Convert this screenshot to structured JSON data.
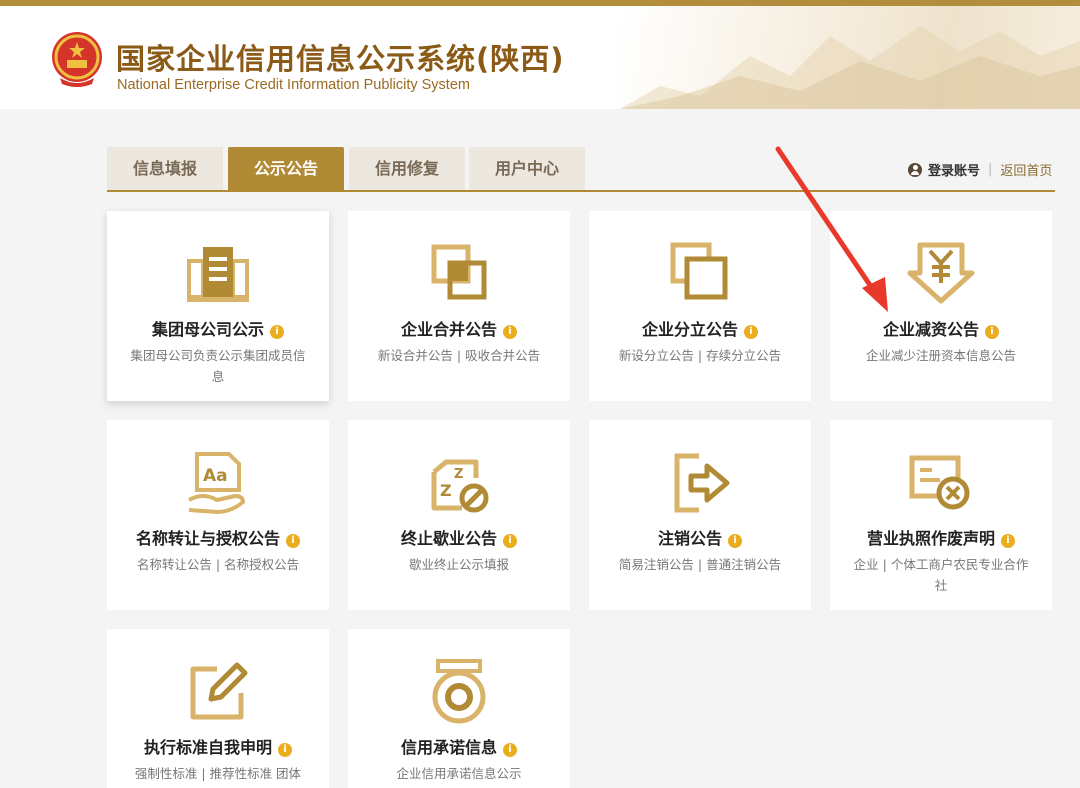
{
  "header": {
    "title": "国家企业信用信息公示系统(陕西)",
    "subtitle": "National Enterprise Credit Information Publicity System"
  },
  "nav": {
    "tabs": [
      {
        "label": "信息填报",
        "active": false
      },
      {
        "label": "公示公告",
        "active": true
      },
      {
        "label": "信用修复",
        "active": false
      },
      {
        "label": "用户中心",
        "active": false
      }
    ],
    "login_label": "登录账号",
    "home_label": "返回首页"
  },
  "colors": {
    "accent": "#b08a35",
    "info_badge": "#e9ad1e",
    "title": "#8b5a16",
    "annotation_arrow": "#e8392a"
  },
  "cards": [
    {
      "title": "集团母公司公示",
      "desc": "集团母公司负责公示集团成员信息",
      "icon": "building-icon"
    },
    {
      "title": "企业合并公告",
      "desc": "新设合并公告 | 吸收合并公告",
      "icon": "merge-icon"
    },
    {
      "title": "企业分立公告",
      "desc": "新设分立公告 | 存续分立公告",
      "icon": "split-icon"
    },
    {
      "title": "企业减资公告",
      "desc": "企业减少注册资本信息公告",
      "icon": "yuan-down-icon"
    },
    {
      "title": "名称转让与授权公告",
      "desc": "名称转让公告 | 名称授权公告",
      "icon": "name-transfer-icon"
    },
    {
      "title": "终止歇业公告",
      "desc": "歇业终止公示填报",
      "icon": "sleep-stop-icon"
    },
    {
      "title": "注销公告",
      "desc": "简易注销公告 | 普通注销公告",
      "icon": "exit-icon"
    },
    {
      "title": "营业执照作废声明",
      "desc": "企业 | 个体工商户农民专业合作社",
      "icon": "license-void-icon"
    },
    {
      "title": "执行标准自我申明",
      "desc": "强制性标准 | 推荐性标准 团体",
      "icon": "edit-icon"
    },
    {
      "title": "信用承诺信息",
      "desc": "企业信用承诺信息公示",
      "icon": "medal-icon"
    }
  ]
}
